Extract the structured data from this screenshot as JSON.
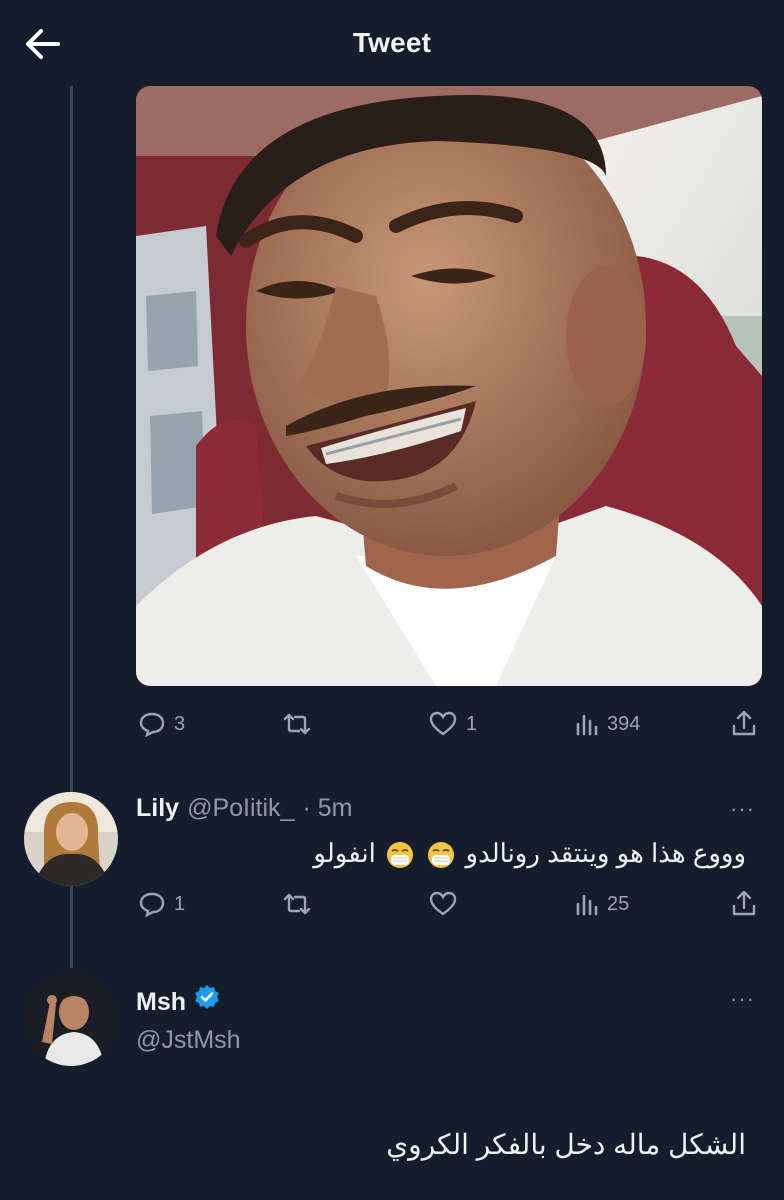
{
  "header": {
    "title": "Tweet"
  },
  "icons": {
    "back": "back-arrow-icon",
    "reply": "reply-bubble-icon",
    "retweet": "retweet-icon",
    "like": "heart-icon",
    "views": "views-bar-chart-icon",
    "share": "share-upload-icon",
    "verified": "verified-badge-icon",
    "more": "more-dots-icon"
  },
  "colors": {
    "background": "#141d2b",
    "verified": "#1d9bf0",
    "muted": "#8f99a4"
  },
  "main_tweet": {
    "stats": {
      "replies": "3",
      "retweets": "",
      "likes": "1",
      "views": "394"
    }
  },
  "reply1": {
    "display_name": "Lily",
    "handle": "@PoIitik_",
    "time": "· 5m",
    "more": "···",
    "text_part1": "وووع هذا هو وينتقد رونالدو",
    "text_part2": "انفولو",
    "emoji_names": [
      "mask-face-emoji",
      "mask-face-emoji"
    ],
    "stats": {
      "replies": "1",
      "retweets": "",
      "likes": "",
      "views": "25"
    }
  },
  "reply2": {
    "display_name": "Msh",
    "handle": "@JstMsh",
    "more": "···",
    "verified": true,
    "text": "الشكل ماله دخل بالفكر الكروي"
  }
}
